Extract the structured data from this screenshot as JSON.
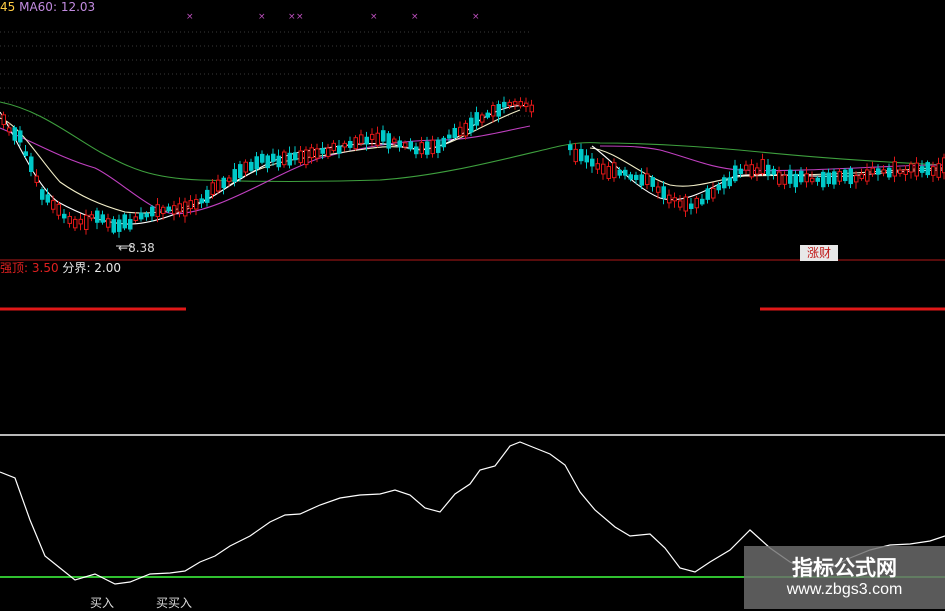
{
  "chart_data": [
    {
      "type": "candlestick",
      "legend": {
        "prefix": "45",
        "ma_label": "MA60",
        "ma_value": "12.03"
      },
      "low_marker": "8.38",
      "signal_box": "涨财",
      "series": [
        {
          "name": "MA60",
          "color": "#3ea03e"
        },
        {
          "color": "#c040c0"
        },
        {
          "color": "#f2eec8"
        },
        {
          "color": "#ffffff"
        }
      ],
      "up_color": "#e01818",
      "down_color": "#00c8c8"
    },
    {
      "type": "bar",
      "legend": {
        "name1": "强顶",
        "value1": "3.50",
        "name2": "分界",
        "value2": "2.00"
      },
      "level_line_color": "#e01818"
    },
    {
      "type": "line",
      "series": [
        {
          "color": "#ffffff"
        }
      ],
      "baseline_color": "#30c030",
      "signals": [
        "买入",
        "买买入"
      ]
    }
  ],
  "watermark": {
    "title": "指标公式网",
    "url": "www.zbgs3.com"
  }
}
